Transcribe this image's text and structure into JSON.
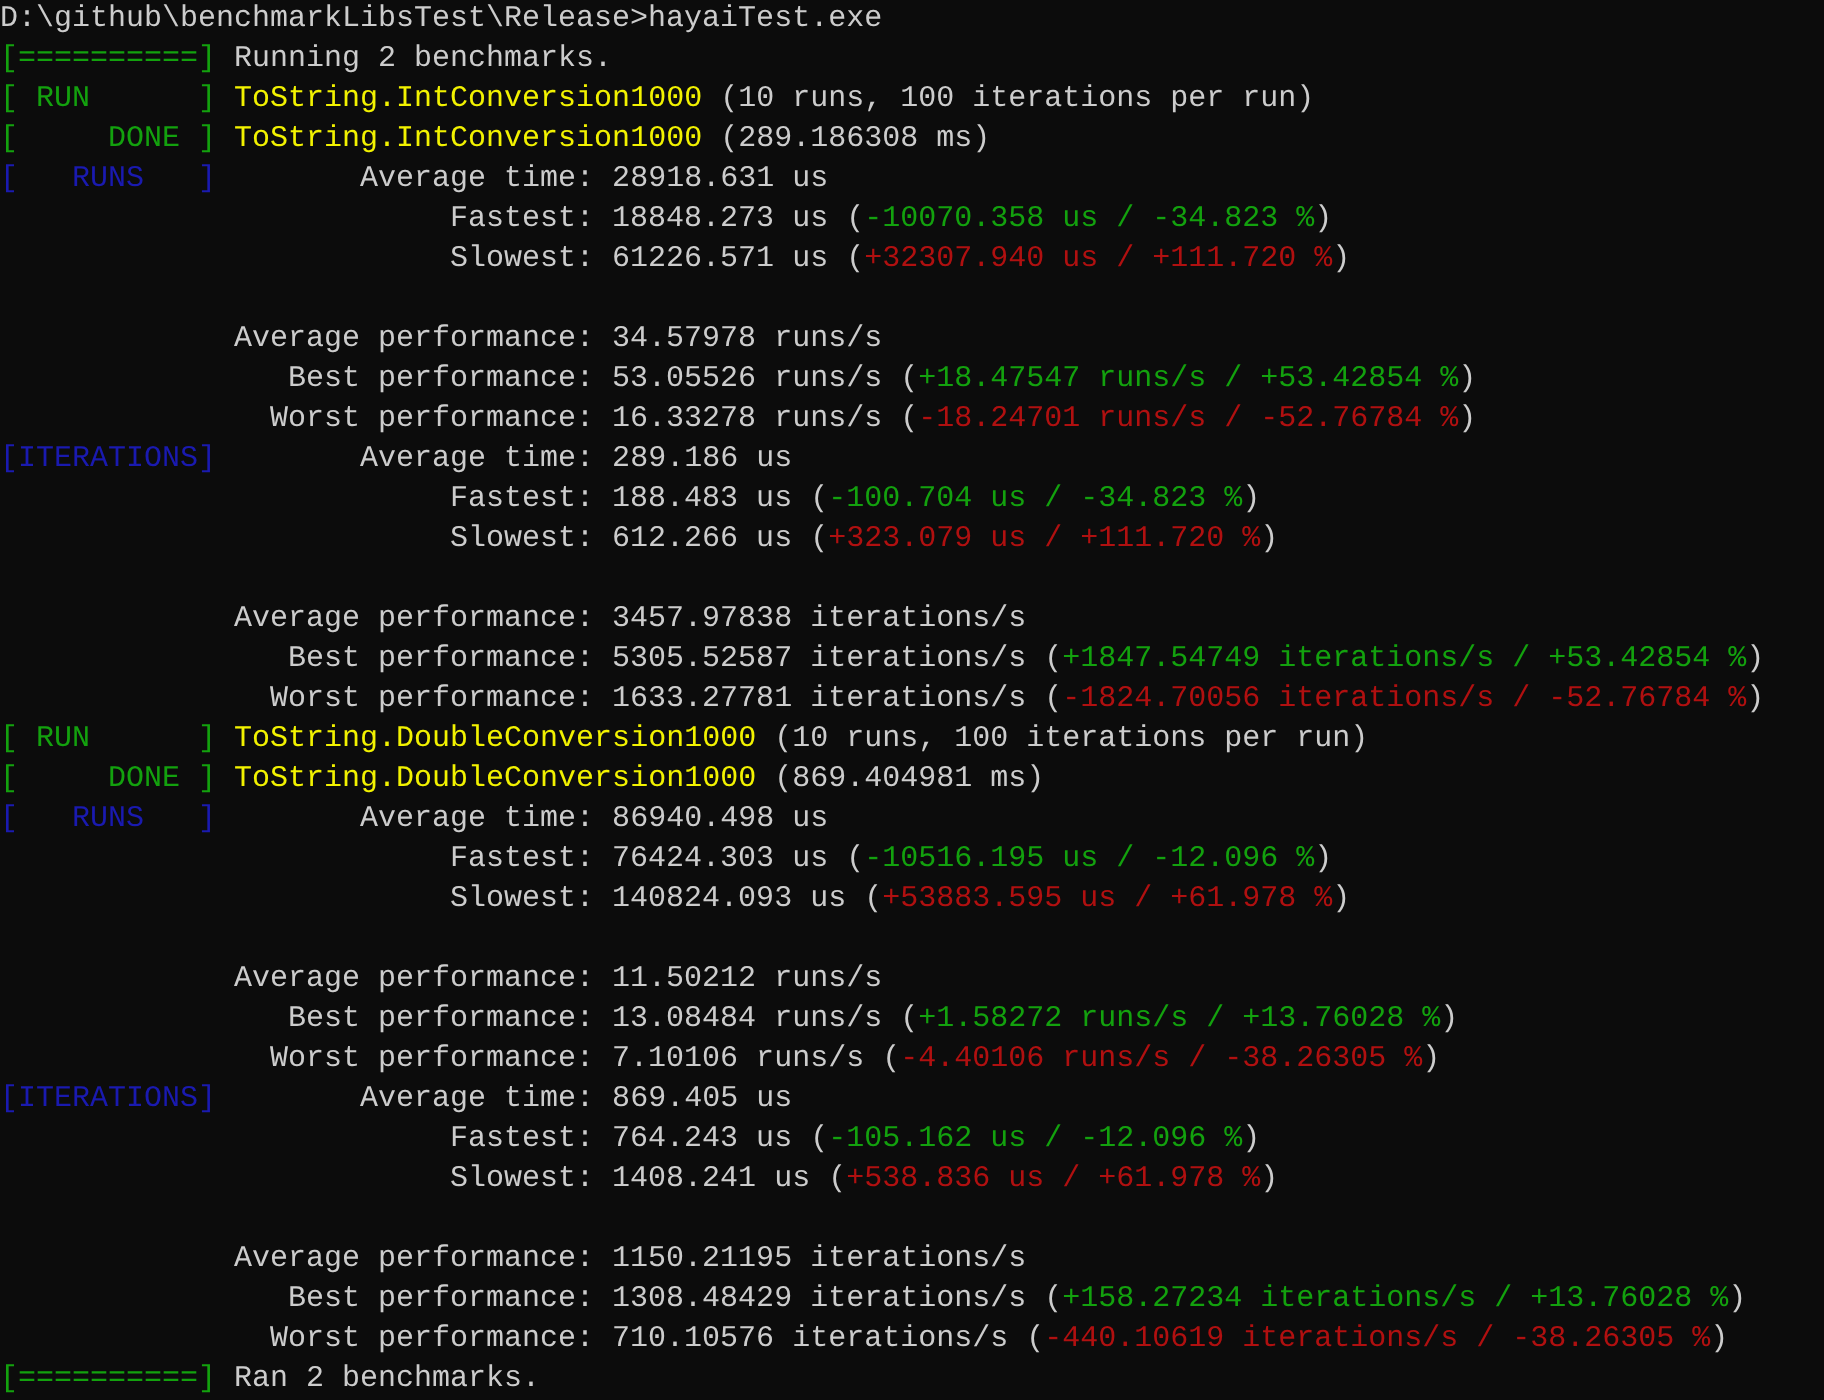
{
  "console": {
    "lines": [
      {
        "kind": "output",
        "segments": [
          {
            "kind": "plain",
            "text": "D:\\github\\benchmarkLibsTest\\Release>hayaiTest.exe"
          }
        ]
      },
      {
        "kind": "output",
        "segments": [
          {
            "kind": "tag_pass",
            "text": "[==========]"
          },
          {
            "kind": "plain",
            "text": "Running 2 benchmarks."
          }
        ]
      },
      {
        "kind": "output",
        "segments": [
          {
            "kind": "tag_pass",
            "text": "[ RUN      ]"
          },
          {
            "kind": "name",
            "text": "ToString.IntConversion1000"
          },
          {
            "kind": "plain",
            "text": " (10 runs, 100 iterations per run)"
          }
        ]
      },
      {
        "kind": "output",
        "segments": [
          {
            "kind": "tag_pass",
            "text": "[     DONE ]"
          },
          {
            "kind": "name",
            "text": "ToString.IntConversion1000"
          },
          {
            "kind": "plain",
            "text": " (289.186308 ms)"
          }
        ]
      },
      {
        "kind": "output",
        "segments": [
          {
            "kind": "tag_info",
            "text": "[   RUNS   ]"
          },
          {
            "kind": "plain",
            "text": "       Average time: 28918.631 us"
          }
        ]
      },
      {
        "kind": "output",
        "segments": [
          {
            "kind": "plain",
            "text": "                         Fastest: 18848.273 us ("
          },
          {
            "kind": "good",
            "text": "-10070.358 us / -34.823 %"
          },
          {
            "kind": "plain",
            "text": ")"
          }
        ]
      },
      {
        "kind": "output",
        "segments": [
          {
            "kind": "plain",
            "text": "                         Slowest: 61226.571 us ("
          },
          {
            "kind": "bad",
            "text": "+32307.940 us / +111.720 %"
          },
          {
            "kind": "plain",
            "text": ")"
          }
        ]
      },
      {
        "kind": "blank"
      },
      {
        "kind": "output",
        "segments": [
          {
            "kind": "plain",
            "text": "             Average performance: 34.57978 runs/s"
          }
        ]
      },
      {
        "kind": "output",
        "segments": [
          {
            "kind": "plain",
            "text": "                Best performance: 53.05526 runs/s ("
          },
          {
            "kind": "good",
            "text": "+18.47547 runs/s / +53.42854 %"
          },
          {
            "kind": "plain",
            "text": ")"
          }
        ]
      },
      {
        "kind": "output",
        "segments": [
          {
            "kind": "plain",
            "text": "               Worst performance: 16.33278 runs/s ("
          },
          {
            "kind": "bad",
            "text": "-18.24701 runs/s / -52.76784 %"
          },
          {
            "kind": "plain",
            "text": ")"
          }
        ]
      },
      {
        "kind": "output",
        "segments": [
          {
            "kind": "tag_info",
            "text": "[ITERATIONS]"
          },
          {
            "kind": "plain",
            "text": "       Average time: 289.186 us"
          }
        ]
      },
      {
        "kind": "output",
        "segments": [
          {
            "kind": "plain",
            "text": "                         Fastest: 188.483 us ("
          },
          {
            "kind": "good",
            "text": "-100.704 us / -34.823 %"
          },
          {
            "kind": "plain",
            "text": ")"
          }
        ]
      },
      {
        "kind": "output",
        "segments": [
          {
            "kind": "plain",
            "text": "                         Slowest: 612.266 us ("
          },
          {
            "kind": "bad",
            "text": "+323.079 us / +111.720 %"
          },
          {
            "kind": "plain",
            "text": ")"
          }
        ]
      },
      {
        "kind": "blank"
      },
      {
        "kind": "output",
        "segments": [
          {
            "kind": "plain",
            "text": "             Average performance: 3457.97838 iterations/s"
          }
        ]
      },
      {
        "kind": "output",
        "segments": [
          {
            "kind": "plain",
            "text": "                Best performance: 5305.52587 iterations/s ("
          },
          {
            "kind": "good",
            "text": "+1847.54749 iterations/s / +53.42854 %"
          },
          {
            "kind": "plain",
            "text": ")"
          }
        ]
      },
      {
        "kind": "output",
        "segments": [
          {
            "kind": "plain",
            "text": "               Worst performance: 1633.27781 iterations/s ("
          },
          {
            "kind": "bad",
            "text": "-1824.70056 iterations/s / -52.76784 %"
          },
          {
            "kind": "plain",
            "text": ")"
          }
        ]
      },
      {
        "kind": "output",
        "segments": [
          {
            "kind": "tag_pass",
            "text": "[ RUN      ]"
          },
          {
            "kind": "name",
            "text": "ToString.DoubleConversion1000"
          },
          {
            "kind": "plain",
            "text": " (10 runs, 100 iterations per run)"
          }
        ]
      },
      {
        "kind": "output",
        "segments": [
          {
            "kind": "tag_pass",
            "text": "[     DONE ]"
          },
          {
            "kind": "name",
            "text": "ToString.DoubleConversion1000"
          },
          {
            "kind": "plain",
            "text": " (869.404981 ms)"
          }
        ]
      },
      {
        "kind": "output",
        "segments": [
          {
            "kind": "tag_info",
            "text": "[   RUNS   ]"
          },
          {
            "kind": "plain",
            "text": "       Average time: 86940.498 us"
          }
        ]
      },
      {
        "kind": "output",
        "segments": [
          {
            "kind": "plain",
            "text": "                         Fastest: 76424.303 us ("
          },
          {
            "kind": "good",
            "text": "-10516.195 us / -12.096 %"
          },
          {
            "kind": "plain",
            "text": ")"
          }
        ]
      },
      {
        "kind": "output",
        "segments": [
          {
            "kind": "plain",
            "text": "                         Slowest: 140824.093 us ("
          },
          {
            "kind": "bad",
            "text": "+53883.595 us / +61.978 %"
          },
          {
            "kind": "plain",
            "text": ")"
          }
        ]
      },
      {
        "kind": "blank"
      },
      {
        "kind": "output",
        "segments": [
          {
            "kind": "plain",
            "text": "             Average performance: 11.50212 runs/s"
          }
        ]
      },
      {
        "kind": "output",
        "segments": [
          {
            "kind": "plain",
            "text": "                Best performance: 13.08484 runs/s ("
          },
          {
            "kind": "good",
            "text": "+1.58272 runs/s / +13.76028 %"
          },
          {
            "kind": "plain",
            "text": ")"
          }
        ]
      },
      {
        "kind": "output",
        "segments": [
          {
            "kind": "plain",
            "text": "               Worst performance: 7.10106 runs/s ("
          },
          {
            "kind": "bad",
            "text": "-4.40106 runs/s / -38.26305 %"
          },
          {
            "kind": "plain",
            "text": ")"
          }
        ]
      },
      {
        "kind": "output",
        "segments": [
          {
            "kind": "tag_info",
            "text": "[ITERATIONS]"
          },
          {
            "kind": "plain",
            "text": "       Average time: 869.405 us"
          }
        ]
      },
      {
        "kind": "output",
        "segments": [
          {
            "kind": "plain",
            "text": "                         Fastest: 764.243 us ("
          },
          {
            "kind": "good",
            "text": "-105.162 us / -12.096 %"
          },
          {
            "kind": "plain",
            "text": ")"
          }
        ]
      },
      {
        "kind": "output",
        "segments": [
          {
            "kind": "plain",
            "text": "                         Slowest: 1408.241 us ("
          },
          {
            "kind": "bad",
            "text": "+538.836 us / +61.978 %"
          },
          {
            "kind": "plain",
            "text": ")"
          }
        ]
      },
      {
        "kind": "blank"
      },
      {
        "kind": "output",
        "segments": [
          {
            "kind": "plain",
            "text": "             Average performance: 1150.21195 iterations/s"
          }
        ]
      },
      {
        "kind": "output",
        "segments": [
          {
            "kind": "plain",
            "text": "                Best performance: 1308.48429 iterations/s ("
          },
          {
            "kind": "good",
            "text": "+158.27234 iterations/s / +13.76028 %"
          },
          {
            "kind": "plain",
            "text": ")"
          }
        ]
      },
      {
        "kind": "output",
        "segments": [
          {
            "kind": "plain",
            "text": "               Worst performance: 710.10576 iterations/s ("
          },
          {
            "kind": "bad",
            "text": "-440.10619 iterations/s / -38.26305 %"
          },
          {
            "kind": "plain",
            "text": ")"
          }
        ]
      },
      {
        "kind": "output",
        "segments": [
          {
            "kind": "tag_pass",
            "text": "[==========]"
          },
          {
            "kind": "plain",
            "text": "Ran 2 benchmarks."
          }
        ]
      }
    ]
  }
}
